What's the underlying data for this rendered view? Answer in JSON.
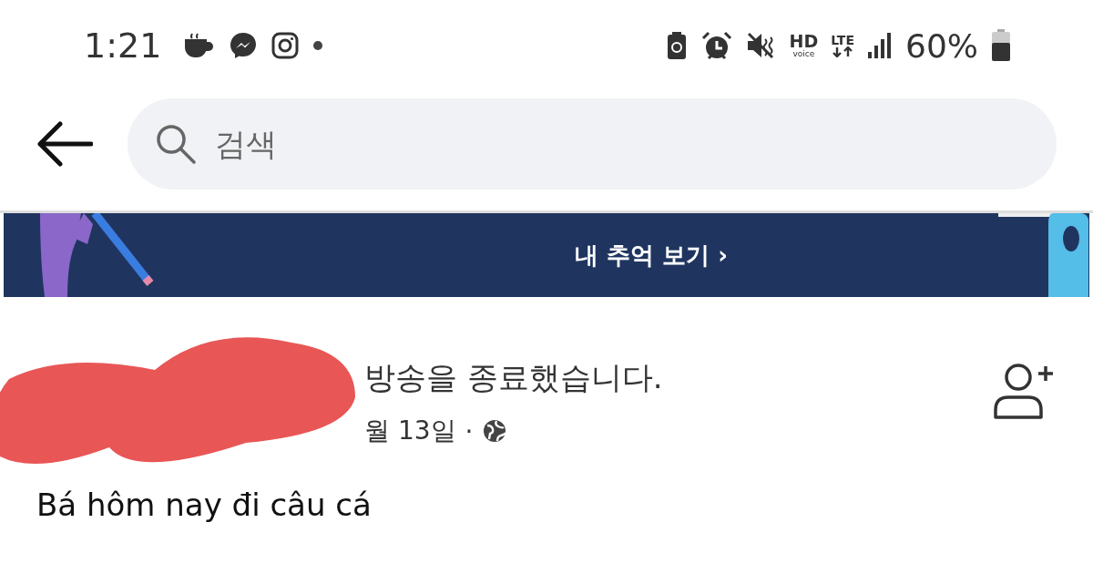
{
  "status_bar": {
    "time": "1:21",
    "hd": "HD",
    "voice": "voice",
    "network": "LTE",
    "battery": "60%"
  },
  "search": {
    "placeholder": "검색"
  },
  "banner": {
    "label": "내 추억 보기 ›"
  },
  "post": {
    "headline": "방송을 종료했습니다.",
    "date": "월 13일",
    "separator": "·",
    "body": "Bá hôm nay đi câu cá"
  }
}
